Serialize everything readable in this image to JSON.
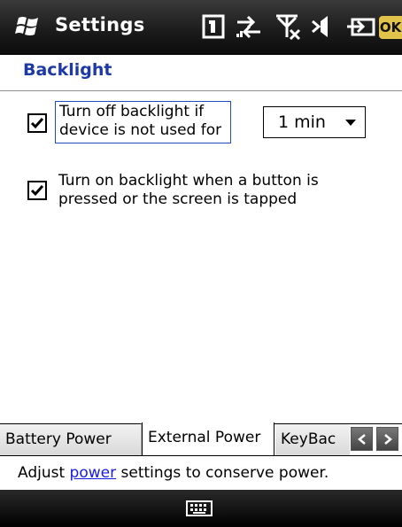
{
  "titlebar": {
    "app_title": "Settings",
    "ok_label": "OK",
    "icons": [
      "windows-logo",
      "sim-card",
      "sync-arrows",
      "no-signal",
      "volume-muted",
      "battery-external"
    ]
  },
  "page": {
    "title": "Backlight"
  },
  "options": {
    "backlight_off": {
      "checked": true,
      "label_line1": "Turn off backlight if",
      "label_line2": "device is not used for",
      "dropdown_value": "1 min"
    },
    "backlight_on": {
      "checked": true,
      "label_line1": "Turn on backlight when a button is",
      "label_line2": "pressed or the screen is tapped"
    }
  },
  "tabs": [
    {
      "label": "Battery Power",
      "selected": false
    },
    {
      "label": "External Power",
      "selected": true
    },
    {
      "label": "KeyBac",
      "selected": false
    }
  ],
  "help": {
    "prefix": "Adjust ",
    "link": "power",
    "suffix": " settings to conserve power."
  },
  "colors": {
    "title_blue": "#1c39a6",
    "link_blue": "#1a1ae6",
    "ok_yellow": "#e1c24a"
  }
}
